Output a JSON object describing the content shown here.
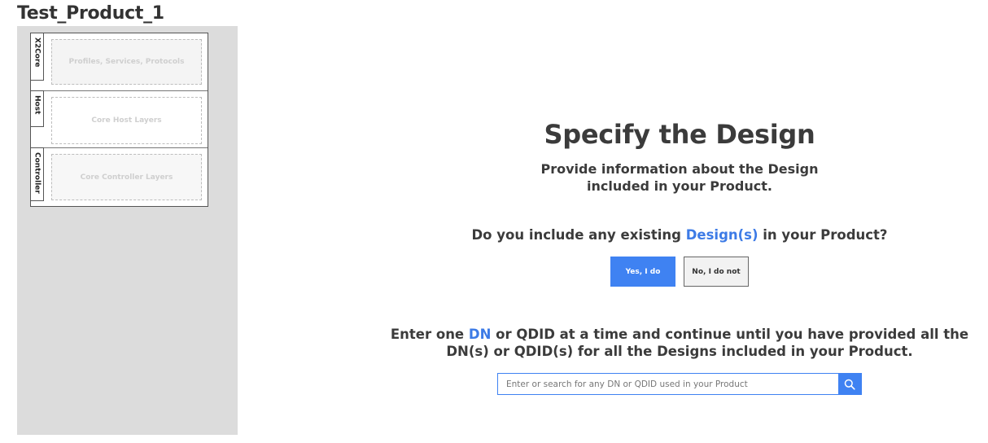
{
  "product": {
    "title": "Test_Product_1"
  },
  "layers": [
    {
      "tab": "X2Core",
      "slot": "Profiles, Services, Protocols"
    },
    {
      "tab": "Host",
      "slot": "Core Host Layers"
    },
    {
      "tab": "Controller",
      "slot": "Core Controller Layers"
    }
  ],
  "main": {
    "heading": "Specify the Design",
    "subheading_line1": "Provide information about the Design",
    "subheading_line2": "included in your Product.",
    "question_prefix": "Do you include any existing ",
    "question_link": "Design(s)",
    "question_suffix": " in your Product?",
    "yes_label": "Yes, I do",
    "no_label": "No, I do not",
    "instruction_prefix": "Enter one ",
    "instruction_link": "DN",
    "instruction_line1_suffix": " or QDID at a time and continue until you have provided all the",
    "instruction_line2": "DN(s) or QDID(s) for all the Designs included in your Product."
  },
  "search": {
    "placeholder": "Enter or search for any DN or QDID used in your Product",
    "icon": "search-icon"
  },
  "colors": {
    "accent": "#3f82f2",
    "sidebar_bg": "#dcdcdc",
    "text": "#3b3b3b"
  }
}
